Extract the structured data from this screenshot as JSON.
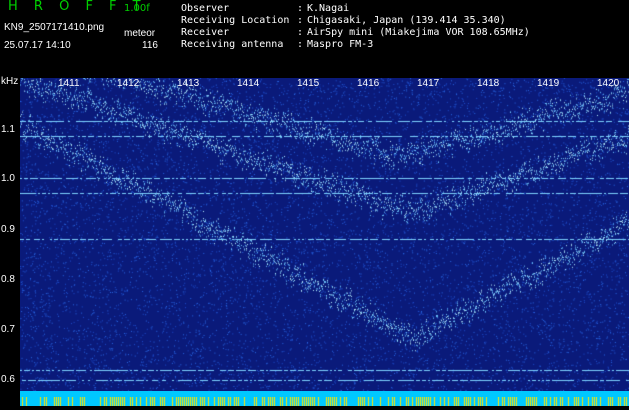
{
  "header": {
    "brand": "H R O F F T",
    "version": "1.00f",
    "filename": "KN9_2507171410.png",
    "mode": "meteor",
    "datetime": "25.07.17 14:10",
    "count": "116",
    "info": [
      {
        "label": "Observer",
        "value": "K.Nagai"
      },
      {
        "label": "Receiving Location",
        "value": "Chigasaki, Japan (139.414 35.340)"
      },
      {
        "label": "Receiver",
        "value": "AirSpy mini (Miakejima VOR 108.65MHz)"
      },
      {
        "label": "Receiving antenna",
        "value": "Maspro FM-3"
      }
    ]
  },
  "axis": {
    "unit": "kHz",
    "y_ticks": [
      "1.1",
      "1.0",
      "0.9",
      "0.8",
      "0.7",
      "0.6"
    ],
    "x_ticks": [
      "1411",
      "1412",
      "1413",
      "1414",
      "1415",
      "1416",
      "1417",
      "1418",
      "1419",
      "1420"
    ]
  },
  "colors": {
    "background": "#000000",
    "brand": "#00d000",
    "plot_bg": "#0a1a7a",
    "signal": "#9ee8ff"
  }
}
